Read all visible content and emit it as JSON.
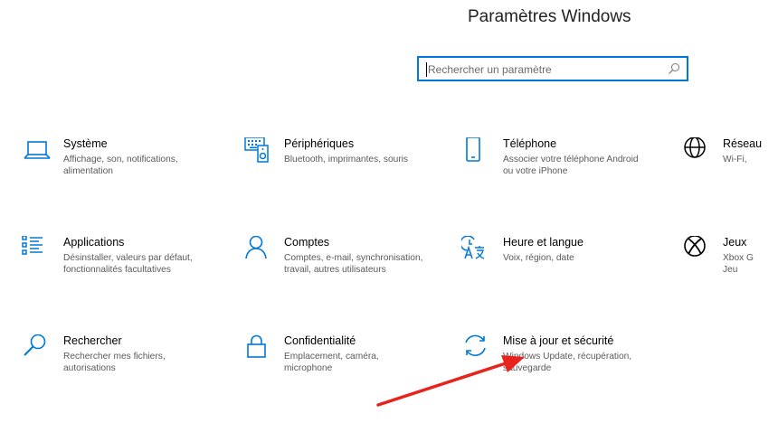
{
  "header": {
    "title": "Paramètres Windows"
  },
  "search": {
    "placeholder": "Rechercher un paramètre",
    "value": ""
  },
  "tiles": [
    {
      "name": "Système",
      "desc": "Affichage, son, notifications, alimentation",
      "icon": "laptop-icon"
    },
    {
      "name": "Périphériques",
      "desc": "Bluetooth, imprimantes, souris",
      "icon": "devices-icon"
    },
    {
      "name": "Téléphone",
      "desc": "Associer votre téléphone Android ou votre iPhone",
      "icon": "phone-icon"
    },
    {
      "name": "Réseau",
      "desc": "Wi-Fi,",
      "icon": "globe-icon"
    },
    {
      "name": "Applications",
      "desc": "Désinstaller, valeurs par défaut, fonctionnalités facultatives",
      "icon": "apps-list-icon"
    },
    {
      "name": "Comptes",
      "desc": "Comptes, e-mail, synchronisation, travail, autres utilisateurs",
      "icon": "person-icon"
    },
    {
      "name": "Heure et langue",
      "desc": "Voix, région, date",
      "icon": "time-language-icon"
    },
    {
      "name": "Jeux",
      "desc": "Xbox G Jeu",
      "icon": "xbox-icon"
    },
    {
      "name": "Rechercher",
      "desc": "Rechercher mes fichiers, autorisations",
      "icon": "search-icon"
    },
    {
      "name": "Confidentialité",
      "desc": "Emplacement, caméra, microphone",
      "icon": "lock-icon"
    },
    {
      "name": "Mise à jour et sécurité",
      "desc": "Windows Update, récupération, sauvegarde",
      "icon": "update-icon"
    }
  ],
  "colors": {
    "accent": "#0078d7",
    "annotation_arrow": "#e8231c"
  }
}
